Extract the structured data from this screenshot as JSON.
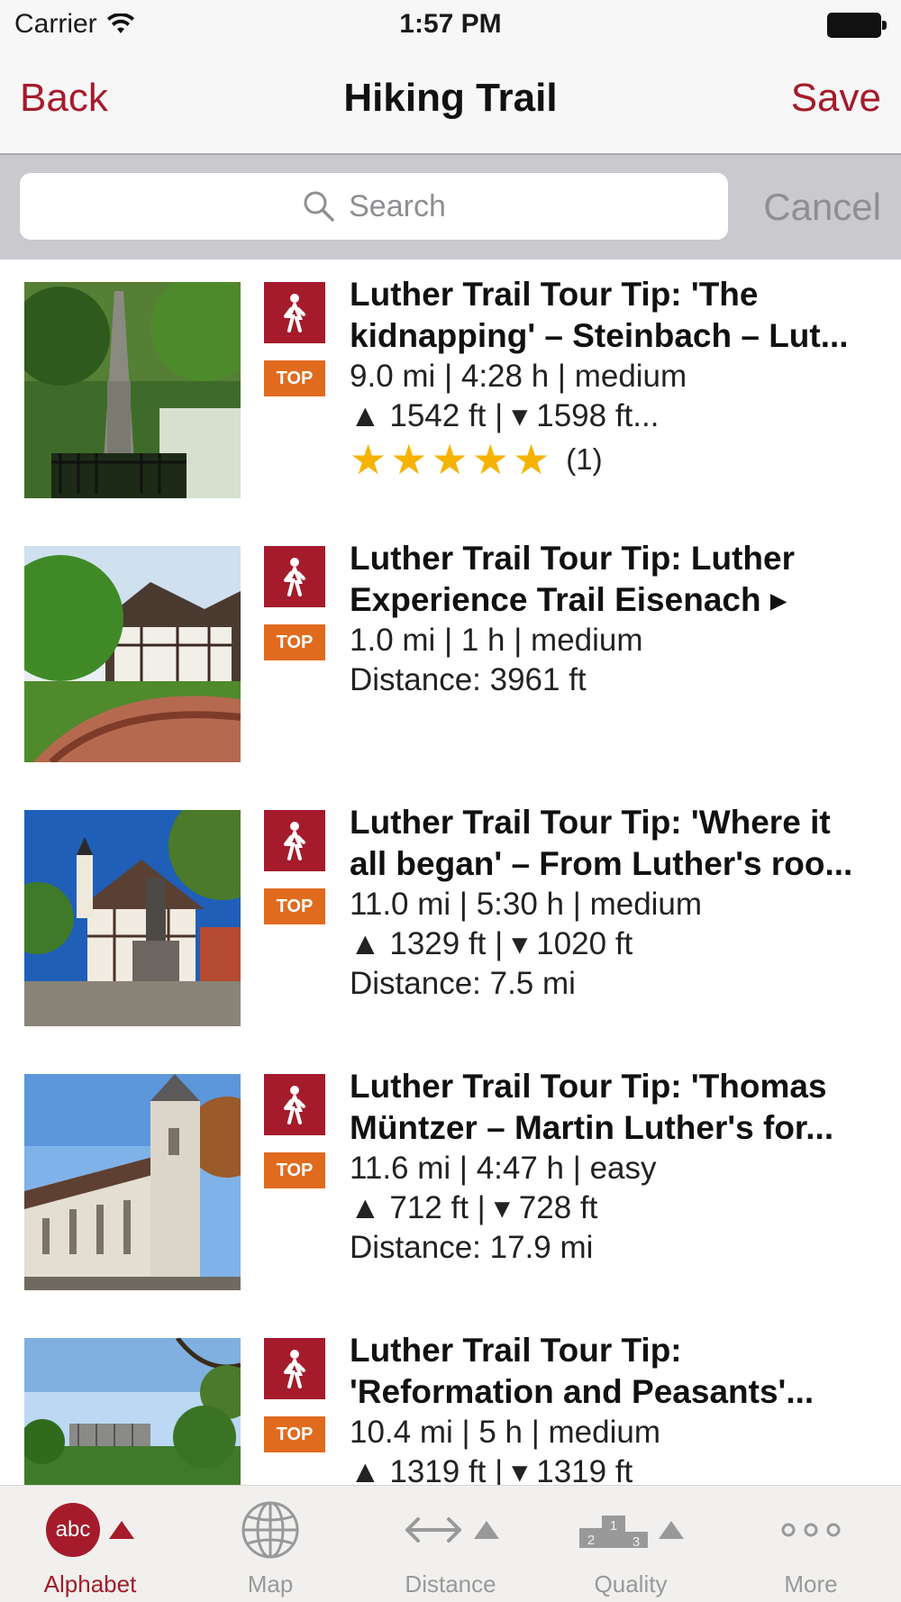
{
  "status_bar": {
    "carrier": "Carrier",
    "time": "1:57 PM"
  },
  "nav": {
    "back": "Back",
    "title": "Hiking Trail",
    "save": "Save"
  },
  "search": {
    "placeholder": "Search",
    "cancel": "Cancel"
  },
  "colors": {
    "accent": "#a51b2b",
    "top_badge": "#e06b1f",
    "star": "#f5b300",
    "inactive": "#999999"
  },
  "items": [
    {
      "title_line1": "Luther Trail Tour Tip: 'The",
      "title_line2": "kidnapping' – Steinbach – Lut...",
      "badge": "TOP",
      "type_icon": "hiker-icon",
      "stats": "9.0 mi | 4:28 h | medium",
      "elevation": "▲ 1542 ft | ▾ 1598 ft...",
      "rating": 5,
      "rating_count": "(1)"
    },
    {
      "title_line1": "Luther Trail Tour Tip: Luther",
      "title_line2": "Experience Trail Eisenach ▸",
      "badge": "TOP",
      "type_icon": "hiker-icon",
      "stats": "1.0 mi | 1 h | medium",
      "distance": "Distance: 3961 ft"
    },
    {
      "title_line1": "Luther Trail Tour Tip: 'Where it",
      "title_line2": "all began' – From Luther's roo...",
      "badge": "TOP",
      "type_icon": "hiker-icon",
      "stats": "11.0 mi | 5:30 h | medium",
      "elevation": "▲ 1329 ft | ▾ 1020 ft",
      "distance": "Distance: 7.5 mi"
    },
    {
      "title_line1": "Luther Trail Tour Tip: 'Thomas",
      "title_line2": "Müntzer – Martin Luther's for...",
      "badge": "TOP",
      "type_icon": "hiker-icon",
      "stats": "11.6 mi | 4:47 h | easy",
      "elevation": "▲ 712 ft | ▾ 728 ft",
      "distance": "Distance: 17.9 mi"
    },
    {
      "title_line1": "Luther Trail Tour Tip:",
      "title_line2": "'Reformation and Peasants'...",
      "badge": "TOP",
      "type_icon": "hiker-icon",
      "stats": "10.4 mi | 5 h | medium",
      "elevation": "▲ 1319 ft | ▾ 1319 ft"
    }
  ],
  "tabs": [
    {
      "label": "Alphabet",
      "icon": "abc-icon",
      "icon_text": "abc",
      "active": true
    },
    {
      "label": "Map",
      "icon": "globe-icon",
      "active": false
    },
    {
      "label": "Distance",
      "icon": "double-arrow-icon",
      "active": false
    },
    {
      "label": "Quality",
      "icon": "podium-icon",
      "icon_text_1": "2",
      "icon_text_2": "1",
      "icon_text_3": "3",
      "active": false
    },
    {
      "label": "More",
      "icon": "more-dots-icon",
      "active": false
    }
  ]
}
